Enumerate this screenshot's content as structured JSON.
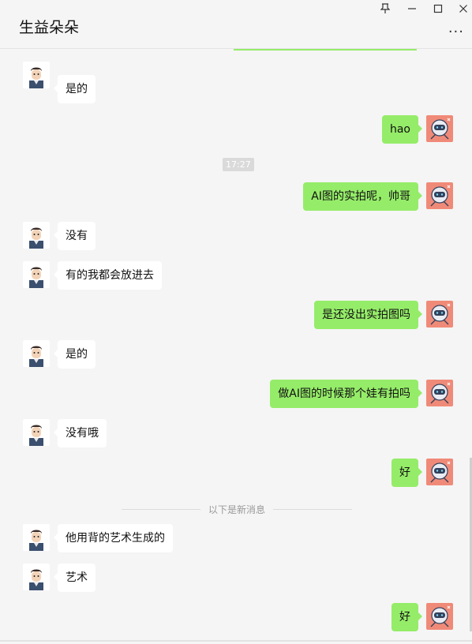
{
  "window": {
    "title": "生益朵朵",
    "pin_icon": "pin-icon",
    "minimize_icon": "minimize-icon",
    "maximize_icon": "maximize-icon",
    "close_icon": "close-icon",
    "more_icon": "more-icon"
  },
  "chat": {
    "time_marker": "17:27",
    "divider": "以下是新消息",
    "messages": [
      {
        "side": "left",
        "text": "是的"
      },
      {
        "side": "right",
        "text": "hao"
      },
      {
        "side": "right",
        "text": "AI图的实拍呢，帅哥"
      },
      {
        "side": "left",
        "text": "没有"
      },
      {
        "side": "left",
        "text": "有的我都会放进去"
      },
      {
        "side": "right",
        "text": "是还没出实拍图吗"
      },
      {
        "side": "left",
        "text": "是的"
      },
      {
        "side": "right",
        "text": "做AI图的时候那个娃有拍吗"
      },
      {
        "side": "left",
        "text": "没有哦"
      },
      {
        "side": "right",
        "text": "好"
      },
      {
        "side": "left",
        "text": "他用背的艺术生成的"
      },
      {
        "side": "left",
        "text": "艺术"
      },
      {
        "side": "right",
        "text": "好"
      }
    ]
  },
  "colors": {
    "my_bubble": "#95ec69",
    "their_bubble": "#ffffff",
    "background": "#f5f5f5"
  }
}
